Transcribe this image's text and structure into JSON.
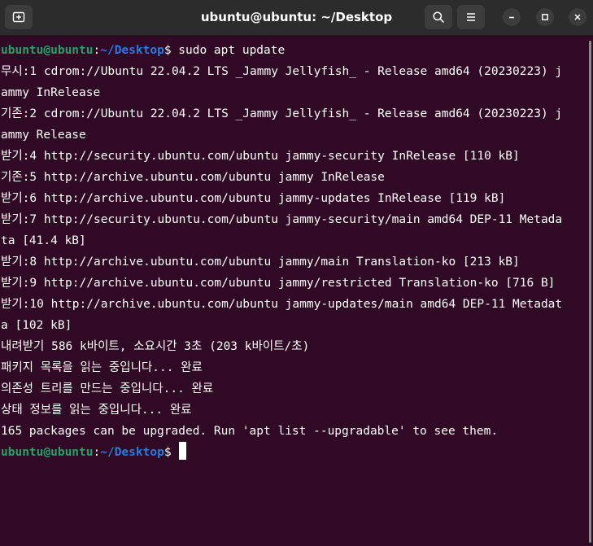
{
  "window": {
    "title": "ubuntu@ubuntu: ~/Desktop"
  },
  "colors": {
    "background": "#300a24",
    "prompt_user": "#26a269",
    "prompt_path": "#2a7bde",
    "titlebar": "#2c2c2c"
  },
  "icons": {
    "new_tab": "new-tab-icon",
    "search": "search-icon",
    "menu": "hamburger-menu-icon",
    "minimize": "minimize-icon",
    "maximize": "maximize-icon",
    "close": "close-icon"
  },
  "prompt": {
    "user_host": "ubuntu@ubuntu",
    "colon": ":",
    "path": "~/Desktop",
    "dollar": "$"
  },
  "command": " sudo apt update",
  "output": [
    "무시:1 cdrom://Ubuntu 22.04.2 LTS _Jammy Jellyfish_ - Release amd64 (20230223) j",
    "ammy InRelease",
    "기존:2 cdrom://Ubuntu 22.04.2 LTS _Jammy Jellyfish_ - Release amd64 (20230223) j",
    "ammy Release",
    "받기:4 http://security.ubuntu.com/ubuntu jammy-security InRelease [110 kB]",
    "기존:5 http://archive.ubuntu.com/ubuntu jammy InRelease",
    "받기:6 http://archive.ubuntu.com/ubuntu jammy-updates InRelease [119 kB]",
    "받기:7 http://security.ubuntu.com/ubuntu jammy-security/main amd64 DEP-11 Metada",
    "ta [41.4 kB]",
    "받기:8 http://archive.ubuntu.com/ubuntu jammy/main Translation-ko [213 kB]",
    "받기:9 http://archive.ubuntu.com/ubuntu jammy/restricted Translation-ko [716 B]",
    "받기:10 http://archive.ubuntu.com/ubuntu jammy-updates/main amd64 DEP-11 Metadat",
    "a [102 kB]",
    "내려받기 586 k바이트, 소요시간 3초 (203 k바이트/초)",
    "패키지 목록을 읽는 중입니다... 완료",
    "의존성 트리를 만드는 중입니다... 완료",
    "상태 정보를 읽는 중입니다... 완료",
    "165 packages can be upgraded. Run 'apt list --upgradable' to see them."
  ]
}
